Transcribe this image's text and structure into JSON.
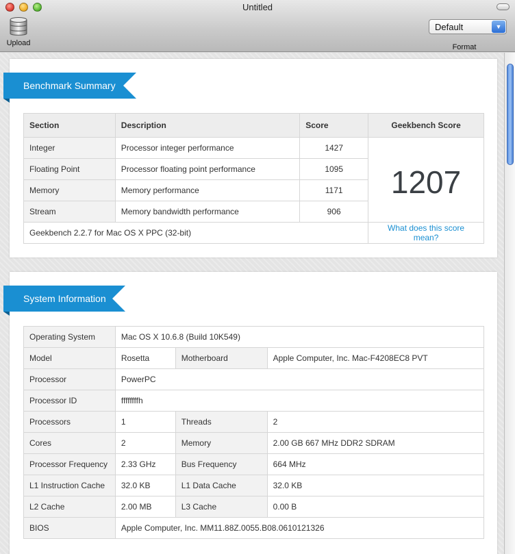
{
  "window": {
    "title": "Untitled"
  },
  "toolbar": {
    "upload_label": "Upload",
    "format_value": "Default",
    "format_label": "Format"
  },
  "icons": {
    "upload": "database-icon",
    "format_arrow": "chevron-down-icon"
  },
  "colors": {
    "accent": "#1a8fd2"
  },
  "benchmark": {
    "heading": "Benchmark Summary",
    "columns": [
      "Section",
      "Description",
      "Score",
      "Geekbench Score"
    ],
    "rows": [
      {
        "section": "Integer",
        "description": "Processor integer performance",
        "score": "1427"
      },
      {
        "section": "Floating Point",
        "description": "Processor floating point performance",
        "score": "1095"
      },
      {
        "section": "Memory",
        "description": "Memory performance",
        "score": "1171"
      },
      {
        "section": "Stream",
        "description": "Memory bandwidth performance",
        "score": "906"
      }
    ],
    "geekbench_score": "1207",
    "footer_version": "Geekbench 2.2.7 for Mac OS X PPC (32-bit)",
    "footer_link": "What does this score mean?"
  },
  "system": {
    "heading": "System Information",
    "rows": [
      {
        "label": "Operating System",
        "value": "Mac OS X 10.6.8 (Build 10K549)"
      },
      {
        "label": "Model",
        "value": "Rosetta",
        "label2": "Motherboard",
        "value2": "Apple Computer, Inc. Mac-F4208EC8 PVT"
      },
      {
        "label": "Processor",
        "value": "PowerPC"
      },
      {
        "label": "Processor ID",
        "value": "ffffffffh"
      },
      {
        "label": "Processors",
        "value": "1",
        "label2": "Threads",
        "value2": "2"
      },
      {
        "label": "Cores",
        "value": "2",
        "label2": "Memory",
        "value2": "2.00 GB 667 MHz DDR2 SDRAM"
      },
      {
        "label": "Processor Frequency",
        "value": "2.33 GHz",
        "label2": "Bus Frequency",
        "value2": "664 MHz"
      },
      {
        "label": "L1 Instruction Cache",
        "value": "32.0 KB",
        "label2": "L1 Data Cache",
        "value2": "32.0 KB"
      },
      {
        "label": "L2 Cache",
        "value": "2.00 MB",
        "label2": "L3 Cache",
        "value2": "0.00 B"
      },
      {
        "label": "BIOS",
        "value": "Apple Computer, Inc. MM11.88Z.0055.B08.0610121326"
      }
    ]
  }
}
